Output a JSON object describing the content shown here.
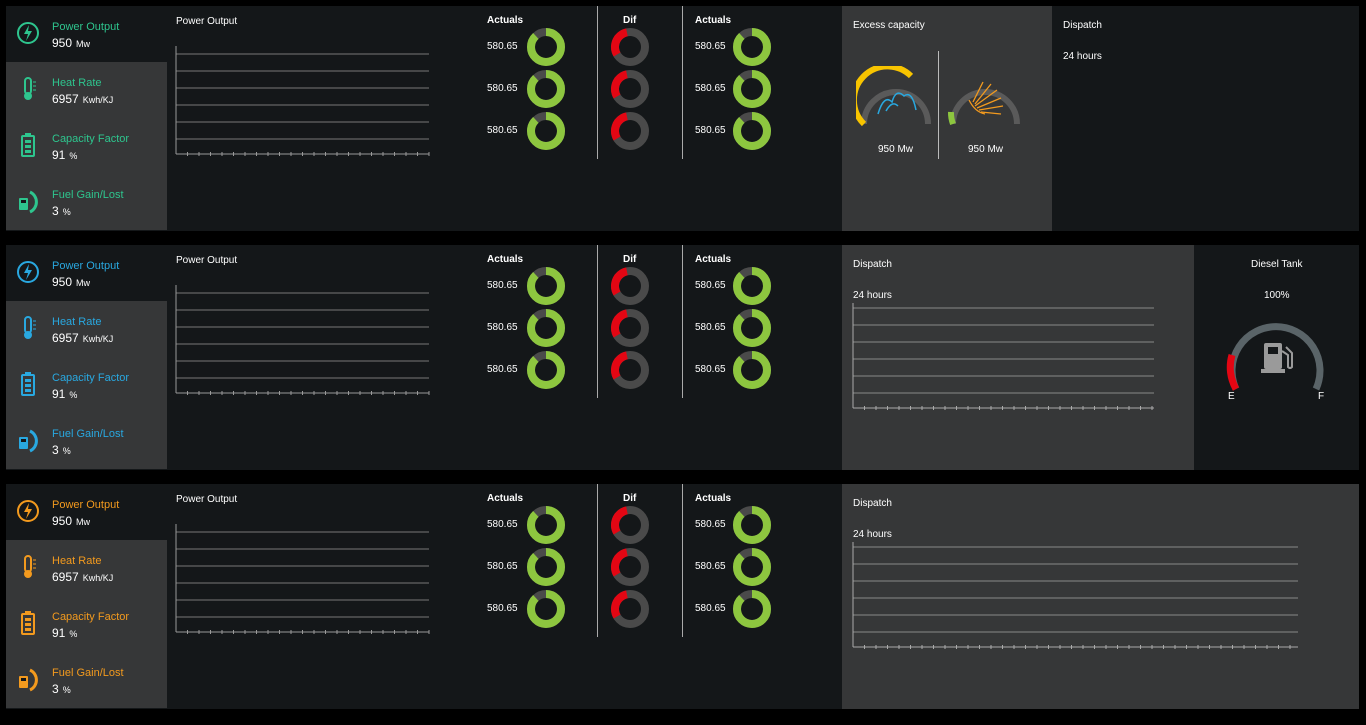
{
  "colors": {
    "green": "#2ec58e",
    "blue": "#29a8e0",
    "orange": "#f39a1e",
    "donut_ok": "#8dc63f",
    "donut_bad": "#e30613",
    "donut_track": "#4a4a4a"
  },
  "rows": [
    {
      "theme": "green",
      "kpis": [
        {
          "icon": "lightning-icon",
          "label": "Power Output",
          "value": "950",
          "unit": "Mw"
        },
        {
          "icon": "thermometer-icon",
          "label": "Heat Rate",
          "value": "6957",
          "unit": "Kwh/KJ"
        },
        {
          "icon": "battery-icon",
          "label": "Capacity Factor",
          "value": "91",
          "unit": "%"
        },
        {
          "icon": "fuel-pump-icon",
          "label": "Fuel Gain/Lost",
          "value": "3",
          "unit": "%"
        }
      ],
      "power_title": "Power Output",
      "actuals_title": "Actuals",
      "dif_title": "Dif",
      "actuals2_title": "Actuals",
      "actuals_values": [
        "580.65",
        "580.65",
        "580.65"
      ],
      "actuals2_values": [
        "580.65",
        "580.65",
        "580.65"
      ],
      "excess": {
        "title": "Excess capacity",
        "left_value": "950 Mw",
        "right_value": "950 Mw"
      },
      "dispatch": {
        "title": "Dispatch",
        "subtitle": "24 hours"
      }
    },
    {
      "theme": "blue",
      "kpis": [
        {
          "icon": "lightning-icon",
          "label": "Power Output",
          "value": "950",
          "unit": "Mw"
        },
        {
          "icon": "thermometer-icon",
          "label": "Heat Rate",
          "value": "6957",
          "unit": "Kwh/KJ"
        },
        {
          "icon": "battery-icon",
          "label": "Capacity Factor",
          "value": "91",
          "unit": "%"
        },
        {
          "icon": "fuel-pump-icon",
          "label": "Fuel Gain/Lost",
          "value": "3",
          "unit": "%"
        }
      ],
      "power_title": "Power Output",
      "actuals_title": "Actuals",
      "dif_title": "Dif",
      "actuals2_title": "Actuals",
      "actuals_values": [
        "580.65",
        "580.65",
        "580.65"
      ],
      "actuals2_values": [
        "580.65",
        "580.65",
        "580.65"
      ],
      "dispatch": {
        "title": "Dispatch",
        "subtitle": "24 hours"
      },
      "diesel": {
        "title": "Diesel Tank",
        "percent": "100%",
        "empty_label": "E",
        "full_label": "F"
      }
    },
    {
      "theme": "orange",
      "kpis": [
        {
          "icon": "lightning-icon",
          "label": "Power Output",
          "value": "950",
          "unit": "Mw"
        },
        {
          "icon": "thermometer-icon",
          "label": "Heat Rate",
          "value": "6957",
          "unit": "Kwh/KJ"
        },
        {
          "icon": "battery-icon",
          "label": "Capacity Factor",
          "value": "91",
          "unit": "%"
        },
        {
          "icon": "fuel-pump-icon",
          "label": "Fuel Gain/Lost",
          "value": "3",
          "unit": "%"
        }
      ],
      "power_title": "Power Output",
      "actuals_title": "Actuals",
      "dif_title": "Dif",
      "actuals2_title": "Actuals",
      "actuals_values": [
        "580.65",
        "580.65",
        "580.65"
      ],
      "actuals2_values": [
        "580.65",
        "580.65",
        "580.65"
      ],
      "dispatch": {
        "title": "Dispatch",
        "subtitle": "24 hours"
      }
    }
  ]
}
